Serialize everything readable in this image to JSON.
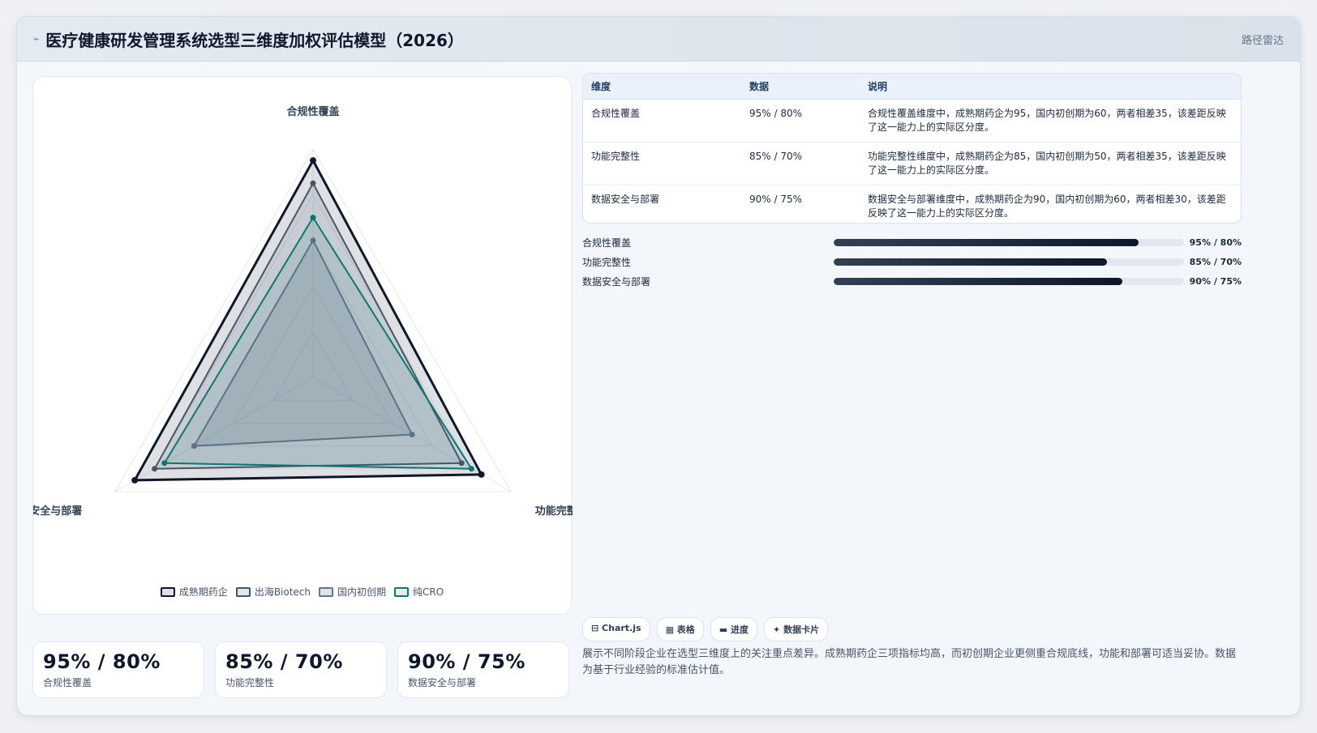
{
  "header": {
    "title": "医疗健康研发管理系统选型三维度加权评估模型（2026）",
    "tag": "路径雷达"
  },
  "chart_data": {
    "type": "radar",
    "axes": [
      "合规性覆盖",
      "功能完整性",
      "数据安全与部署"
    ],
    "range": [
      0,
      100
    ],
    "series": [
      {
        "name": "成熟期药企",
        "values": [
          95,
          85,
          90
        ],
        "color": "#0f172a",
        "fill": "rgba(71,85,105,0.18)"
      },
      {
        "name": "出海Biotech",
        "values": [
          85,
          75,
          80
        ],
        "color": "#475569",
        "fill": "rgba(100,116,139,0.18)"
      },
      {
        "name": "国内初创期",
        "values": [
          60,
          50,
          60
        ],
        "color": "#64748b",
        "fill": "rgba(100,116,139,0.20)"
      },
      {
        "name": "纯CRO",
        "values": [
          70,
          80,
          75
        ],
        "color": "#0f766e",
        "fill": "rgba(15,118,110,0.12)"
      }
    ]
  },
  "kpis": [
    {
      "value": "95% / 80%",
      "label": "合规性覆盖"
    },
    {
      "value": "85% / 70%",
      "label": "功能完整性"
    },
    {
      "value": "90% / 75%",
      "label": "数据安全与部署"
    }
  ],
  "table": {
    "headers": [
      "维度",
      "数据",
      "说明"
    ],
    "rows": [
      [
        "合规性覆盖",
        "95% / 80%",
        "合规性覆盖维度中，成熟期药企为95，国内初创期为60，两者相差35，该差距反映了这一能力上的实际区分度。"
      ],
      [
        "功能完整性",
        "85% / 70%",
        "功能完整性维度中，成熟期药企为85，国内初创期为50，两者相差35，该差距反映了这一能力上的实际区分度。"
      ],
      [
        "数据安全与部署",
        "90% / 75%",
        "数据安全与部署维度中，成熟期药企为90，国内初创期为60，两者相差30，该差距反映了这一能力上的实际区分度。"
      ]
    ]
  },
  "bars": [
    {
      "label": "合规性覆盖",
      "value": "95% / 80%",
      "fill_fraction": 0.87
    },
    {
      "label": "功能完整性",
      "value": "85% / 70%",
      "fill_fraction": 0.78
    },
    {
      "label": "数据安全与部署",
      "value": "90% / 75%",
      "fill_fraction": 0.825
    }
  ],
  "chips": [
    "⊟ Chart.js",
    "▦ 表格",
    "▬ 进度",
    "✦ 数据卡片"
  ],
  "description": "展示不同阶段企业在选型三维度上的关注重点差异。成熟期药企三项指标均高，而初创期企业更侧重合规底线，功能和部署可适当妥协。数据为基于行业经验的标准估计值。"
}
